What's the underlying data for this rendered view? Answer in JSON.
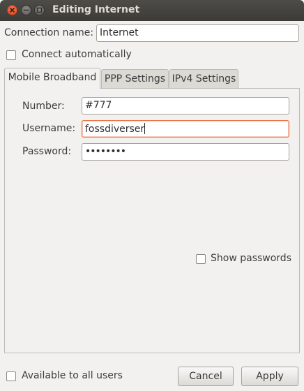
{
  "window": {
    "title": "Editing Internet"
  },
  "connection": {
    "name_label": "Connection name:",
    "name_value": "Internet",
    "auto_connect_label": "Connect automatically"
  },
  "tabs": [
    {
      "label": "Mobile Broadband",
      "active": true
    },
    {
      "label": "PPP Settings",
      "active": false
    },
    {
      "label": "IPv4 Settings",
      "active": false
    }
  ],
  "mobile_broadband": {
    "number_label": "Number:",
    "number_value": "#777",
    "username_label": "Username:",
    "username_value": "fossdiverser",
    "password_label": "Password:",
    "password_value": "••••••••",
    "show_passwords_label": "Show passwords"
  },
  "footer": {
    "available_label": "Available to all users",
    "cancel_label": "Cancel",
    "apply_label": "Apply"
  },
  "colors": {
    "titlebar": "#3c3b37",
    "window_bg": "#f2f1f0",
    "focus_accent": "#e96e3f",
    "close_button": "#df4a16"
  },
  "icons": {
    "close": "close-icon",
    "minimize": "minimize-icon",
    "maximize": "maximize-icon"
  }
}
